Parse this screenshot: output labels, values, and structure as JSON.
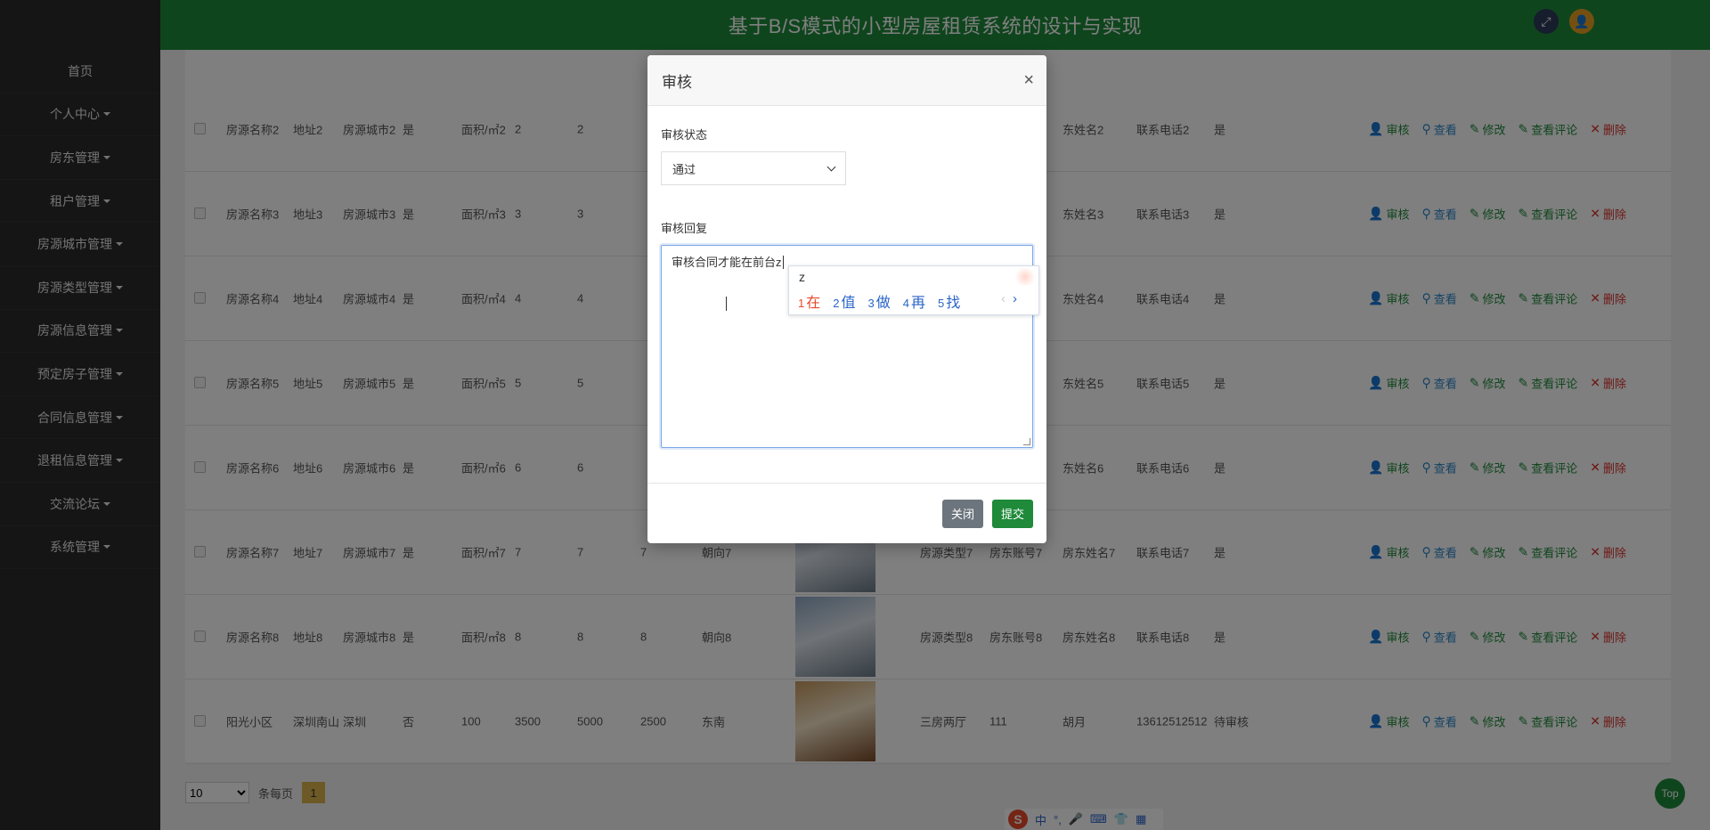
{
  "header": {
    "title": "基于B/S模式的小型房屋租赁系统的设计与实现"
  },
  "sidebar": {
    "items": [
      {
        "label": "首页",
        "caret": false
      },
      {
        "label": "个人中心",
        "caret": true
      },
      {
        "label": "房东管理",
        "caret": true
      },
      {
        "label": "租户管理",
        "caret": true
      },
      {
        "label": "房源城市管理",
        "caret": true
      },
      {
        "label": "房源类型管理",
        "caret": true
      },
      {
        "label": "房源信息管理",
        "caret": true
      },
      {
        "label": "预定房子管理",
        "caret": true
      },
      {
        "label": "合同信息管理",
        "caret": true
      },
      {
        "label": "退租信息管理",
        "caret": true
      },
      {
        "label": "交流论坛",
        "caret": true
      },
      {
        "label": "系统管理",
        "caret": true
      }
    ]
  },
  "table": {
    "rows": [
      {
        "name": "房源名称2",
        "addr": "地址2",
        "city": "房源城市2",
        "flag": "是",
        "area": "面积/㎡2",
        "c1": "2",
        "c2": "2",
        "c3": "",
        "dir": "",
        "type": "",
        "acct": "",
        "owner": "东姓名2",
        "phone": "联系电话2",
        "status": "是",
        "thumb": false
      },
      {
        "name": "房源名称3",
        "addr": "地址3",
        "city": "房源城市3",
        "flag": "是",
        "area": "面积/㎡3",
        "c1": "3",
        "c2": "3",
        "c3": "",
        "dir": "",
        "type": "",
        "acct": "",
        "owner": "东姓名3",
        "phone": "联系电话3",
        "status": "是",
        "thumb": false
      },
      {
        "name": "房源名称4",
        "addr": "地址4",
        "city": "房源城市4",
        "flag": "是",
        "area": "面积/㎡4",
        "c1": "4",
        "c2": "4",
        "c3": "",
        "dir": "",
        "type": "",
        "acct": "",
        "owner": "东姓名4",
        "phone": "联系电话4",
        "status": "是",
        "thumb": false
      },
      {
        "name": "房源名称5",
        "addr": "地址5",
        "city": "房源城市5",
        "flag": "是",
        "area": "面积/㎡5",
        "c1": "5",
        "c2": "5",
        "c3": "",
        "dir": "",
        "type": "",
        "acct": "",
        "owner": "东姓名5",
        "phone": "联系电话5",
        "status": "是",
        "thumb": false
      },
      {
        "name": "房源名称6",
        "addr": "地址6",
        "city": "房源城市6",
        "flag": "是",
        "area": "面积/㎡6",
        "c1": "6",
        "c2": "6",
        "c3": "",
        "dir": "",
        "type": "",
        "acct": "",
        "owner": "东姓名6",
        "phone": "联系电话6",
        "status": "是",
        "thumb": false
      },
      {
        "name": "房源名称7",
        "addr": "地址7",
        "city": "房源城市7",
        "flag": "是",
        "area": "面积/㎡7",
        "c1": "7",
        "c2": "7",
        "c3": "7",
        "dir": "朝向7",
        "type": "房源类型7",
        "acct": "房东账号7",
        "owner": "房东姓名7",
        "phone": "联系电话7",
        "status": "是",
        "thumb": true
      },
      {
        "name": "房源名称8",
        "addr": "地址8",
        "city": "房源城市8",
        "flag": "是",
        "area": "面积/㎡8",
        "c1": "8",
        "c2": "8",
        "c3": "8",
        "dir": "朝向8",
        "type": "房源类型8",
        "acct": "房东账号8",
        "owner": "房东姓名8",
        "phone": "联系电话8",
        "status": "是",
        "thumb": true
      },
      {
        "name": "阳光小区",
        "addr": "深圳南山",
        "city": "深圳",
        "flag": "否",
        "area": "100",
        "c1": "3500",
        "c2": "5000",
        "c3": "2500",
        "dir": "东南",
        "type": "三房两厅",
        "acct": "111",
        "owner": "胡月",
        "phone": "13612512512",
        "status": "待审核",
        "thumb": true
      }
    ],
    "actions": {
      "audit": "审核",
      "view": "查看",
      "edit": "修改",
      "comments": "查看评论",
      "delete": "删除"
    }
  },
  "pager": {
    "per_page": "10",
    "per_page_label": "条每页",
    "current_page": "1"
  },
  "top_button": "Top",
  "modal": {
    "title": "审核",
    "status_label": "审核状态",
    "status_value": "通过",
    "reply_label": "审核回复",
    "reply_value": "审核合同才能在前台z",
    "close_button": "关闭",
    "submit_button": "提交"
  },
  "ime": {
    "composition": "z",
    "candidates": [
      {
        "num": "1",
        "text": "在"
      },
      {
        "num": "2",
        "text": "值"
      },
      {
        "num": "3",
        "text": "做"
      },
      {
        "num": "4",
        "text": "再"
      },
      {
        "num": "5",
        "text": "找"
      }
    ],
    "bar": {
      "logo": "S",
      "mode": "中",
      "punct": "°,"
    }
  }
}
